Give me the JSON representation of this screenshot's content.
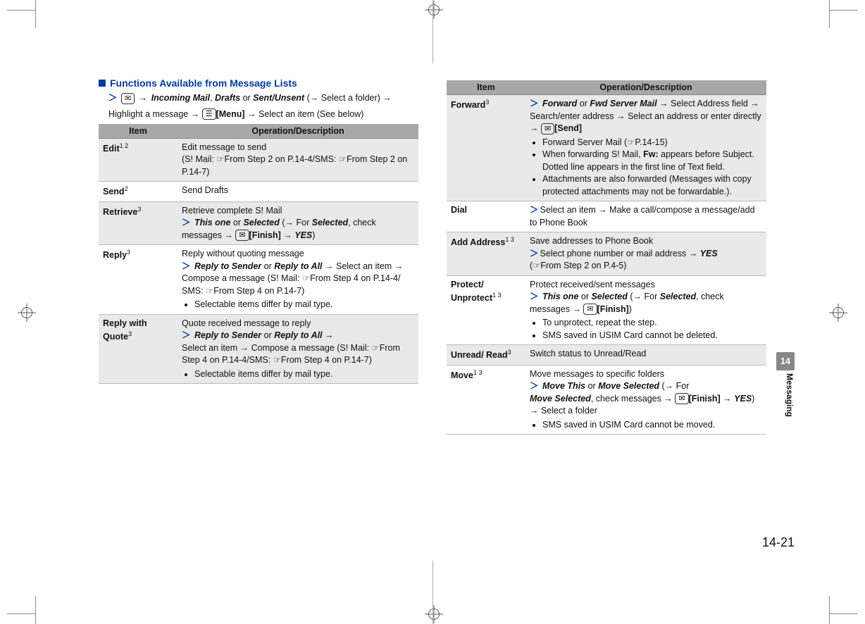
{
  "sidebar": {
    "chapter": "14",
    "label": "Messaging"
  },
  "footer": {
    "pageno": "14-21"
  },
  "left": {
    "heading": "Functions Available from Message Lists",
    "intro_parts": {
      "p1_a": "Incoming Mail",
      "p1_b": "Drafts",
      "p1_c": "Sent/Unsent",
      "p1_d": "(→ Select a folder) →",
      "p2_a": "Highlight a message →",
      "p2_menu": "[Menu]",
      "p2_b": "→ Select an item (See below)"
    },
    "th_item": "Item",
    "th_op": "Operation/Description",
    "rows": [
      {
        "item": "Edit",
        "sup": "1 2",
        "desc_a": "Edit message to send",
        "desc_b": "(S! Mail: ☞From Step 2 on P.14-4/SMS: ☞From Step 2 on P.14-7)"
      },
      {
        "item": "Send",
        "sup": "2",
        "desc_a": "Send Drafts"
      },
      {
        "item": "Retrieve",
        "sup": "3",
        "desc_a": "Retrieve complete S! Mail",
        "sub_bi_a": "This one",
        "sub_or": " or ",
        "sub_bi_b": "Selected",
        "sub_paren": " (→ For ",
        "sub_bi_c": "Selected",
        "sub_tail": ", check messages → ",
        "sub_key": "[Finish]",
        "sub_arrow_yes": " → ",
        "sub_yes": "YES",
        "sub_close": ")"
      },
      {
        "item": "Reply",
        "sup": "3",
        "desc_a": "Reply without quoting message",
        "sub_bi_a": "Reply to Sender",
        "sub_or": " or ",
        "sub_bi_b": "Reply to All",
        "sub_tail": " → Select an item → Compose a message (S! Mail: ☞From Step 4 on P.14-4/ SMS: ☞From Step 4 on P.14-7)",
        "bullet1": "Selectable items differ by mail type."
      },
      {
        "item": "Reply with Quote",
        "sup": "3",
        "desc_a": "Quote received message to reply",
        "sub_bi_a": "Reply to Sender",
        "sub_or": " or ",
        "sub_bi_b": "Reply to All",
        "sub_arrow": " →",
        "sub_tail": "Select an item → Compose a message (S! Mail: ☞From Step 4 on P.14-4/SMS: ☞From Step 4 on P.14-7)",
        "bullet1": "Selectable items differ by mail type."
      }
    ]
  },
  "right": {
    "th_item": "Item",
    "th_op": "Operation/Description",
    "rows": [
      {
        "item": "Forward",
        "sup": "3",
        "sub_bi_a": "Forward",
        "sub_or": " or ",
        "sub_bi_b": "Fwd Server Mail",
        "sub_tail_a": " → Select Address field → Search/enter address → Select an address or enter directly → ",
        "sub_key": "[Send]",
        "bul1": "Forward Server Mail (☞P.14-15)",
        "bul2_a": "When forwarding S! Mail, ",
        "bul2_b": "Fw:",
        "bul2_c": " appears before Subject. Dotted line appears in the first line of Text field.",
        "bul3": "Attachments are also forwarded (Messages with copy protected attachments may not be forwardable.)."
      },
      {
        "item": "Dial",
        "sub_tail": "Select an item → Make a call/compose a message/add to Phone Book"
      },
      {
        "item": "Add Address",
        "sup": "1 3",
        "desc_a": "Save addresses to Phone Book",
        "sub_tail_a": "Select phone number or mail address → ",
        "sub_yes": "YES",
        "sub_paren": "(☞From Step 2 on P.4-5)"
      },
      {
        "item": "Protect/ Unprotect",
        "sup": "1 3",
        "desc_a": "Protect received/sent messages",
        "sub_bi_a": "This one",
        "sub_or": " or ",
        "sub_bi_b": "Selected",
        "sub_paren": " (→ For ",
        "sub_bi_c": "Selected",
        "sub_tail": ", check messages → ",
        "sub_key": "[Finish]",
        "sub_close": ")",
        "bul1": "To unprotect, repeat the step.",
        "bul2": "SMS saved in USIM Card cannot be deleted."
      },
      {
        "item": "Unread/ Read",
        "sup": "3",
        "desc_a": "Switch status to Unread/Read"
      },
      {
        "item": "Move",
        "sup": "1 3",
        "desc_a": "Move messages to specific folders",
        "sub_bi_a": "Move This",
        "sub_or": " or ",
        "sub_bi_b": "Move Selected",
        "sub_paren": " (→ For ",
        "sub_bi_c": "Move Selected",
        "sub_tail": ", check messages → ",
        "sub_key": "[Finish]",
        "sub_arrow_yes": " → ",
        "sub_yes": "YES",
        "sub_close": ") → Select a folder",
        "bul1": "SMS saved in USIM Card cannot be moved."
      }
    ]
  }
}
